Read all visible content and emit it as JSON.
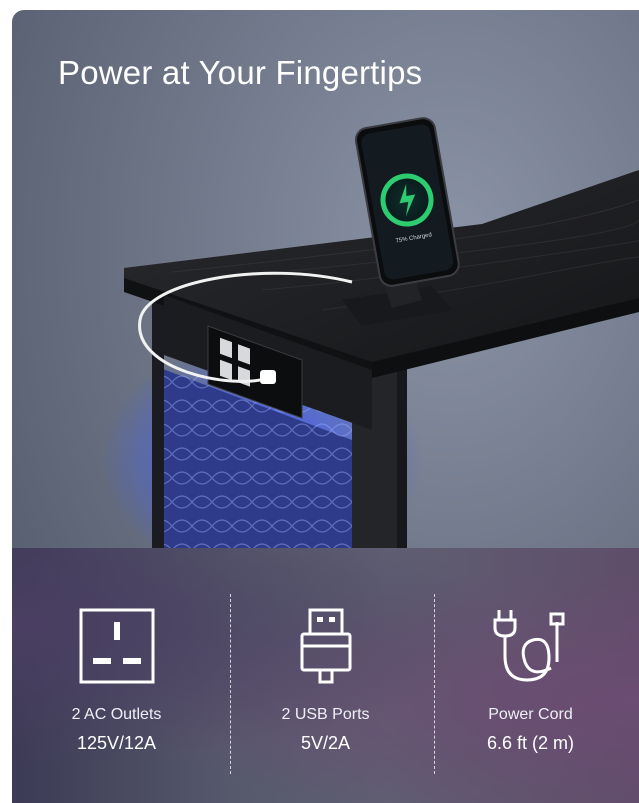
{
  "headline": "Power at Your Fingertips",
  "phone_screen_text": "75% Charged",
  "features": [
    {
      "icon": "ac-outlet-icon",
      "label": "2 AC Outlets",
      "value": "125V/12A"
    },
    {
      "icon": "usb-port-icon",
      "label": "2 USB Ports",
      "value": "5V/2A"
    },
    {
      "icon": "power-cord-icon",
      "label": "Power Cord",
      "value": "6.6 ft (2 m)"
    }
  ],
  "colors": {
    "led_glow": "#3d5cff",
    "panel_bg": "#56596c",
    "desk_top": "#1e1f22"
  }
}
